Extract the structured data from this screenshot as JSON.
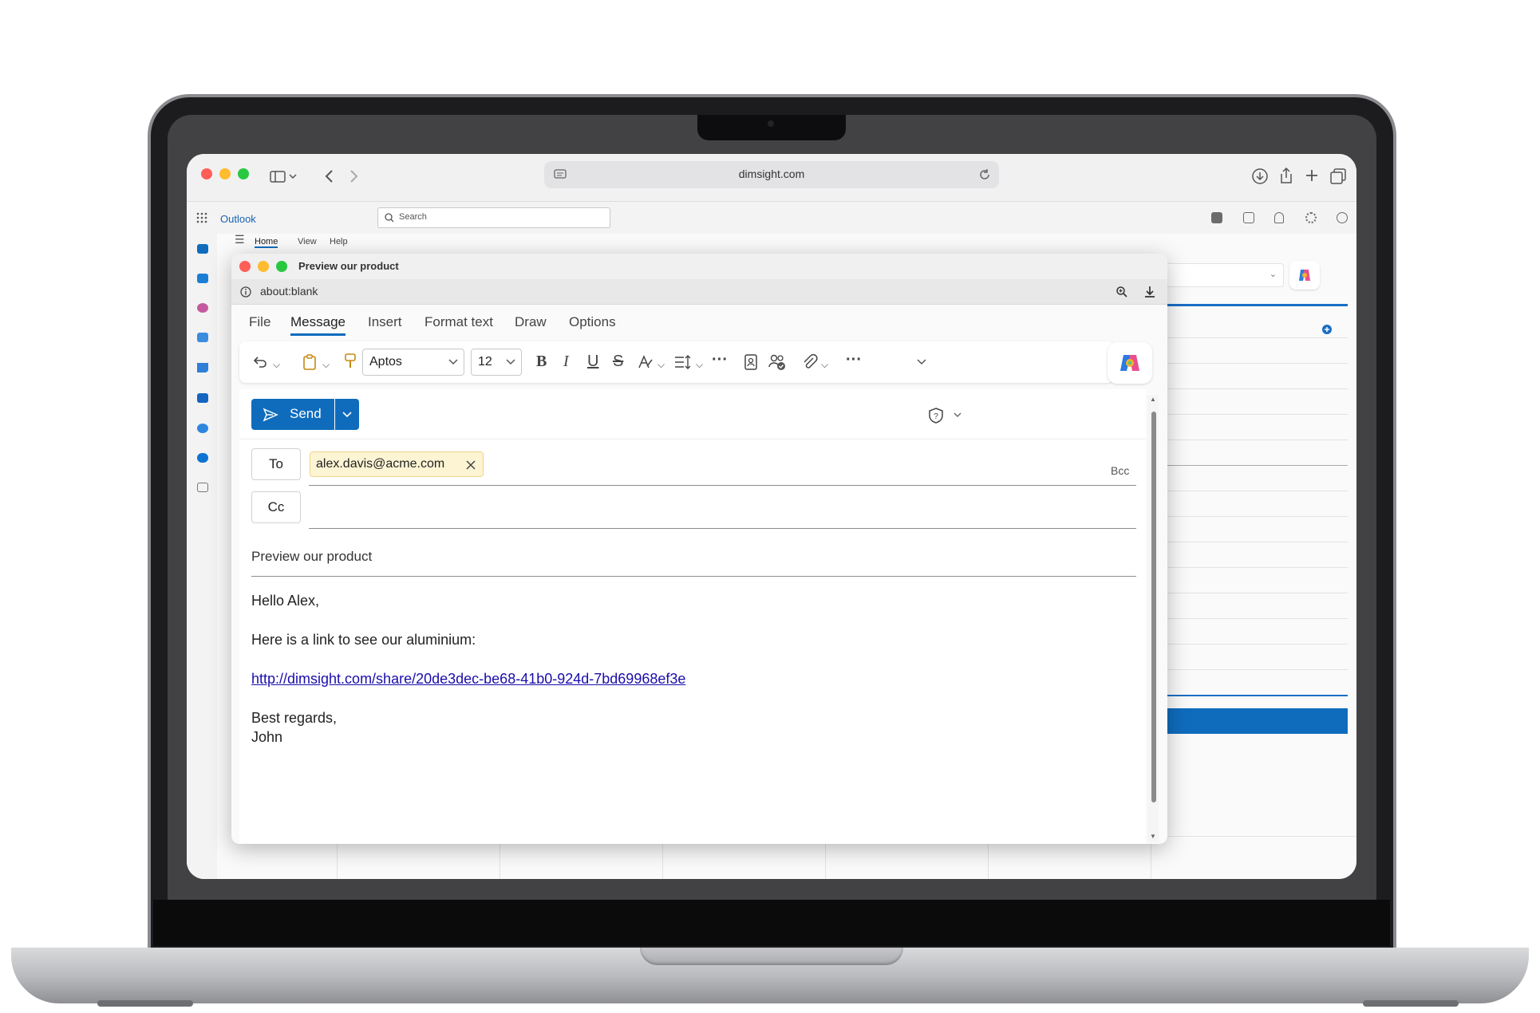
{
  "browser": {
    "url": "dimsight.com"
  },
  "outlook": {
    "app_name": "Outlook",
    "search_placeholder": "Search",
    "tabs": [
      "Home",
      "View",
      "Help"
    ]
  },
  "compose_window": {
    "title": "Preview our product",
    "address": "about:blank",
    "ribbon_tabs": [
      "File",
      "Message",
      "Insert",
      "Format text",
      "Draw",
      "Options"
    ],
    "active_tab": "Message",
    "font_name": "Aptos",
    "font_size": "12",
    "send_label": "Send",
    "to_label": "To",
    "cc_label": "Cc",
    "bcc_label": "Bcc",
    "to_recipient": "alex.davis@acme.com",
    "subject": "Preview our product",
    "body": {
      "greeting": "Hello Alex,",
      "line1": "Here is a link to see our aluminium:",
      "link": "http://dimsight.com/share/20de3dec-be68-41b0-924d-7bd69968ef3e",
      "closing": "Best regards,",
      "signature": "John"
    }
  },
  "colors": {
    "accent": "#0f6cbd",
    "chip_bg": "#fdf4d3"
  }
}
